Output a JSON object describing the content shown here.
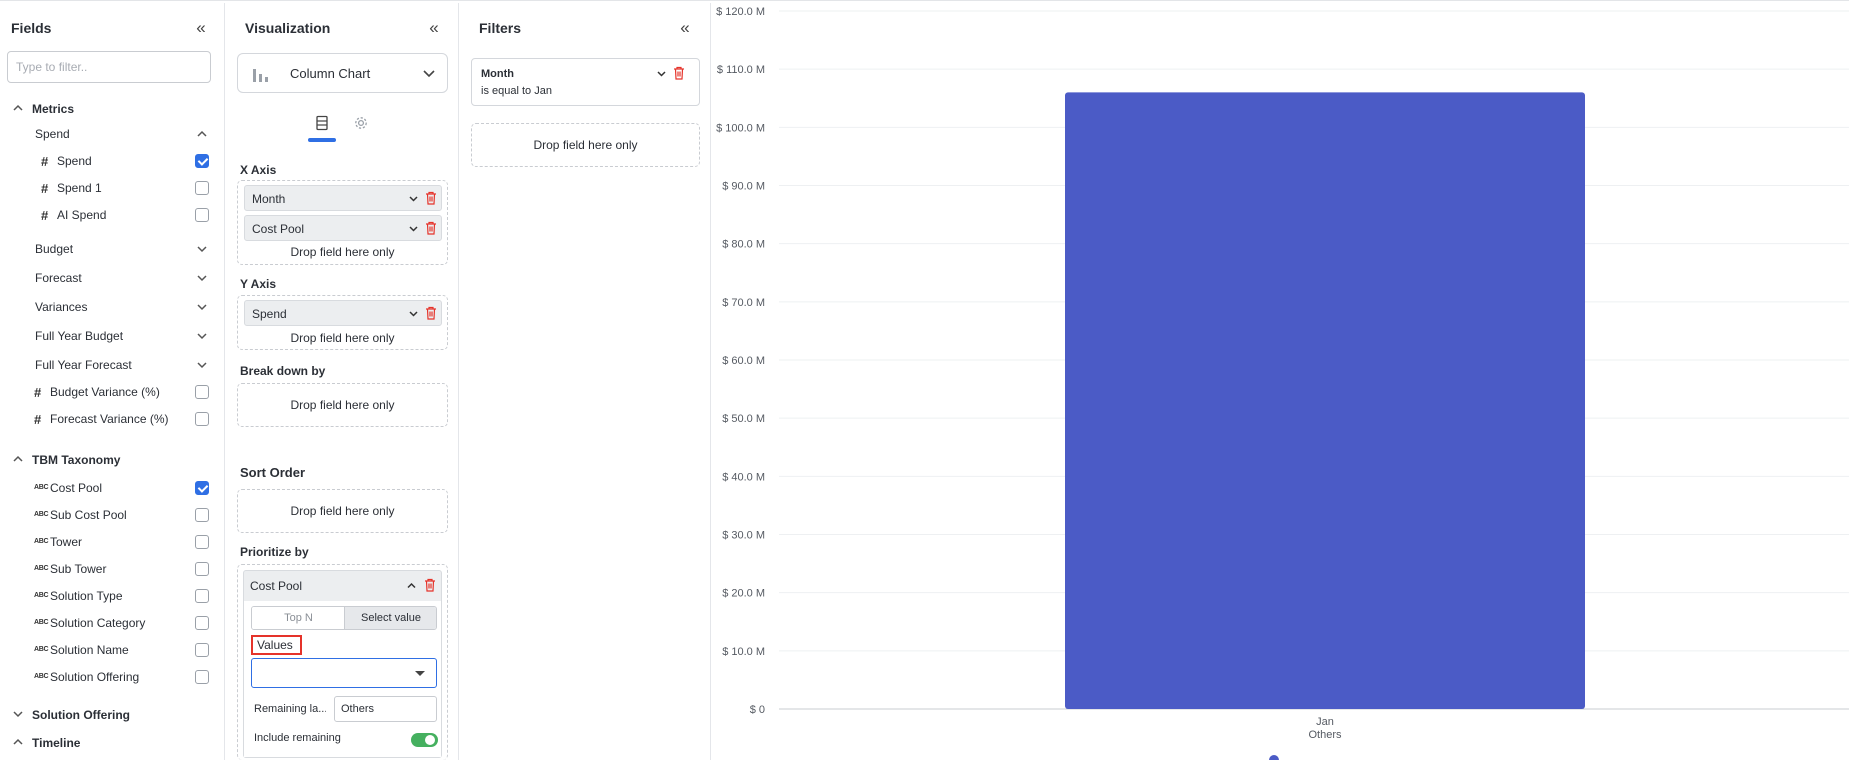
{
  "fields_panel": {
    "title": "Fields",
    "search_placeholder": "Type to filter..",
    "metrics": {
      "label": "Metrics",
      "spend_group": {
        "label": "Spend",
        "items": [
          {
            "label": "Spend",
            "checked": true
          },
          {
            "label": "Spend 1",
            "checked": false
          },
          {
            "label": "AI Spend",
            "checked": false
          }
        ]
      },
      "subgroups": [
        "Budget",
        "Forecast",
        "Variances",
        "Full Year Budget",
        "Full Year Forecast"
      ],
      "items": [
        {
          "label": "Budget Variance (%)",
          "checked": false
        },
        {
          "label": "Forecast Variance (%)",
          "checked": false
        }
      ]
    },
    "tbm_taxonomy": {
      "label": "TBM Taxonomy",
      "items": [
        {
          "label": "Cost Pool",
          "checked": true
        },
        {
          "label": "Sub Cost Pool",
          "checked": false
        },
        {
          "label": "Tower",
          "checked": false
        },
        {
          "label": "Sub Tower",
          "checked": false
        },
        {
          "label": "Solution Type",
          "checked": false
        },
        {
          "label": "Solution Category",
          "checked": false
        },
        {
          "label": "Solution Name",
          "checked": false
        },
        {
          "label": "Solution Offering",
          "checked": false
        }
      ]
    },
    "solution_offering": {
      "label": "Solution Offering"
    },
    "timeline": {
      "label": "Timeline"
    }
  },
  "viz_panel": {
    "title": "Visualization",
    "chart_type": "Column Chart",
    "x_axis": {
      "title": "X Axis",
      "fields": [
        "Month",
        "Cost Pool"
      ],
      "drop_text": "Drop field here only"
    },
    "y_axis": {
      "title": "Y Axis",
      "fields": [
        "Spend"
      ],
      "drop_text": "Drop field here only"
    },
    "breakdown": {
      "title": "Break down by",
      "drop_text": "Drop field here only"
    },
    "sort_order": {
      "title": "Sort Order",
      "drop_text": "Drop field here only"
    },
    "prioritize": {
      "title": "Prioritize by",
      "field": "Cost Pool",
      "options": [
        "Top N",
        "Select value"
      ],
      "values_label": "Values",
      "remaining_label": "Remaining la...",
      "remaining_value": "Others",
      "include_label": "Include remaining",
      "include_on": true
    }
  },
  "filters_panel": {
    "title": "Filters",
    "filter": {
      "field": "Month",
      "condition": "is equal to Jan"
    },
    "drop_text": "Drop field here only"
  },
  "colors": {
    "accent": "#2f6fe4",
    "bar": "#4b5bc6",
    "delete": "#e5332a",
    "toggle": "#45b05f"
  },
  "chart_data": {
    "type": "bar",
    "categories": [
      "Jan"
    ],
    "category_sublabels": [
      "Others"
    ],
    "series": [
      {
        "values": [
          106
        ]
      }
    ],
    "ylim": [
      0,
      120
    ],
    "y_ticks": [
      "$ 0",
      "$ 10.0 M",
      "$ 20.0 M",
      "$ 30.0 M",
      "$ 40.0 M",
      "$ 50.0 M",
      "$ 60.0 M",
      "$ 70.0 M",
      "$ 80.0 M",
      "$ 90.0 M",
      "$ 100.0 M",
      "$ 110.0 M",
      "$ 120.0 M"
    ],
    "grid": true
  }
}
